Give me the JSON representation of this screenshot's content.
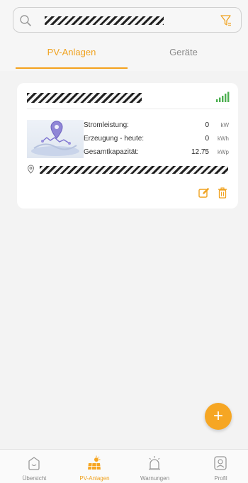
{
  "search": {
    "value": "",
    "filter_icon": "filter-icon",
    "search_icon": "search-icon"
  },
  "tabs": [
    {
      "label": "PV-Anlagen",
      "active": true
    },
    {
      "label": "Geräte",
      "active": false
    }
  ],
  "plant_card": {
    "name": "",
    "signal_icon": "signal-icon",
    "stats": [
      {
        "label": "Stromleistung:",
        "value": "0",
        "unit": "kW"
      },
      {
        "label": "Erzeugung - heute:",
        "value": "0",
        "unit": "kWh"
      },
      {
        "label": "Gesamtkapazität:",
        "value": "12.75",
        "unit": "kWp"
      }
    ],
    "address": "",
    "actions": [
      "edit-icon",
      "trash-icon"
    ]
  },
  "fab": {
    "label": "+"
  },
  "nav": [
    {
      "label": "Übersicht",
      "icon": "home-icon",
      "active": false
    },
    {
      "label": "PV-Anlagen",
      "icon": "solar-panel-icon",
      "active": true
    },
    {
      "label": "Warnungen",
      "icon": "alarm-icon",
      "active": false
    },
    {
      "label": "Profil",
      "icon": "profile-icon",
      "active": false
    }
  ],
  "colors": {
    "accent": "#f6a623",
    "signal": "#4caf50",
    "background": "#f3f3f3"
  }
}
